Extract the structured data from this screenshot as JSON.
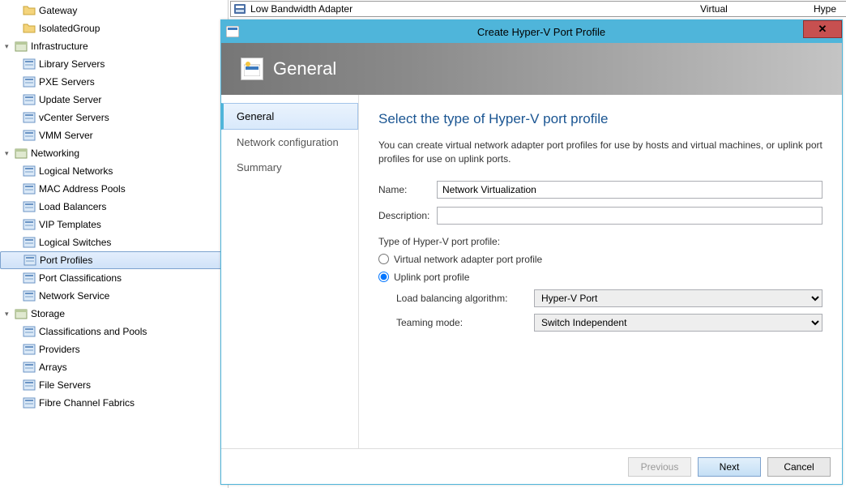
{
  "sidebar": {
    "items": [
      {
        "label": "Gateway",
        "kind": "folder",
        "indent": 1
      },
      {
        "label": "IsolatedGroup",
        "kind": "folder",
        "indent": 1
      },
      {
        "label": "Infrastructure",
        "kind": "category",
        "twisty": "▾"
      },
      {
        "label": "Library Servers",
        "kind": "item",
        "indent": 2
      },
      {
        "label": "PXE Servers",
        "kind": "item",
        "indent": 2
      },
      {
        "label": "Update Server",
        "kind": "item",
        "indent": 2
      },
      {
        "label": "vCenter Servers",
        "kind": "item",
        "indent": 2
      },
      {
        "label": "VMM Server",
        "kind": "item",
        "indent": 2
      },
      {
        "label": "Networking",
        "kind": "category",
        "twisty": "▾"
      },
      {
        "label": "Logical Networks",
        "kind": "item",
        "indent": 2
      },
      {
        "label": "MAC Address Pools",
        "kind": "item",
        "indent": 2
      },
      {
        "label": "Load Balancers",
        "kind": "item",
        "indent": 2
      },
      {
        "label": "VIP Templates",
        "kind": "item",
        "indent": 2
      },
      {
        "label": "Logical Switches",
        "kind": "item",
        "indent": 2
      },
      {
        "label": "Port Profiles",
        "kind": "item",
        "indent": 2,
        "selected": true
      },
      {
        "label": "Port Classifications",
        "kind": "item",
        "indent": 2
      },
      {
        "label": "Network Service",
        "kind": "item",
        "indent": 2
      },
      {
        "label": "Storage",
        "kind": "category",
        "twisty": "▾"
      },
      {
        "label": "Classifications and Pools",
        "kind": "item",
        "indent": 2
      },
      {
        "label": "Providers",
        "kind": "item",
        "indent": 2
      },
      {
        "label": "Arrays",
        "kind": "item",
        "indent": 2
      },
      {
        "label": "File Servers",
        "kind": "item",
        "indent": 2
      },
      {
        "label": "Fibre Channel Fabrics",
        "kind": "item",
        "indent": 2
      }
    ]
  },
  "background_row": {
    "name": "Low Bandwidth Adapter",
    "col2": "Virtual",
    "col3": "Hype"
  },
  "dialog": {
    "title": "Create Hyper-V Port Profile",
    "banner_title": "General",
    "steps": [
      {
        "label": "General",
        "active": true
      },
      {
        "label": "Network configuration"
      },
      {
        "label": "Summary"
      }
    ],
    "heading": "Select the type of Hyper-V port profile",
    "blurb": "You can create virtual network adapter port profiles for use by hosts and virtual machines, or uplink port profiles for use on uplink ports.",
    "name_label": "Name:",
    "name_value": "Network Virtualization",
    "desc_label": "Description:",
    "desc_value": "",
    "type_label": "Type of Hyper-V port profile:",
    "radio1": "Virtual network adapter port profile",
    "radio2": "Uplink port profile",
    "lba_label": "Load balancing algorithm:",
    "lba_value": "Hyper-V Port",
    "teaming_label": "Teaming mode:",
    "teaming_value": "Switch Independent",
    "buttons": {
      "previous": "Previous",
      "next": "Next",
      "cancel": "Cancel"
    }
  }
}
